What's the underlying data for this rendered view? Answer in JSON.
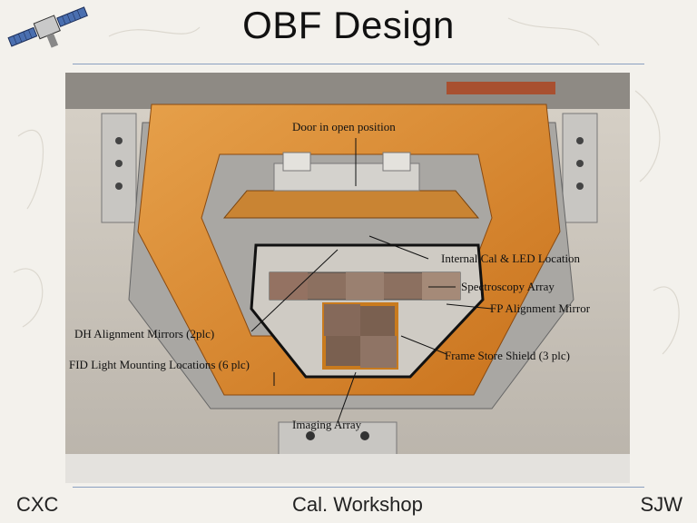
{
  "slide": {
    "title": "OBF Design"
  },
  "callouts": {
    "door": "Door in open position",
    "internal_cal": "Internal Cal & LED Location",
    "spectroscopy": "Spectroscopy Array",
    "fp_mirror": "FP Alignment Mirror",
    "dh_mirrors": "DH Alignment Mirrors  (2plc)",
    "frame_store": "Frame Store Shield (3 plc)",
    "fid_light": "FID Light Mounting Locations (6 plc)",
    "imaging": "Imaging Array"
  },
  "footer": {
    "left": "CXC",
    "center": "Cal. Workshop",
    "right": "SJW"
  },
  "colors": {
    "frame_orange": "#d98a2a",
    "rule": "#8aa0c0",
    "background": "#f3f1ec"
  },
  "icons": {
    "logo": "satellite-icon"
  }
}
